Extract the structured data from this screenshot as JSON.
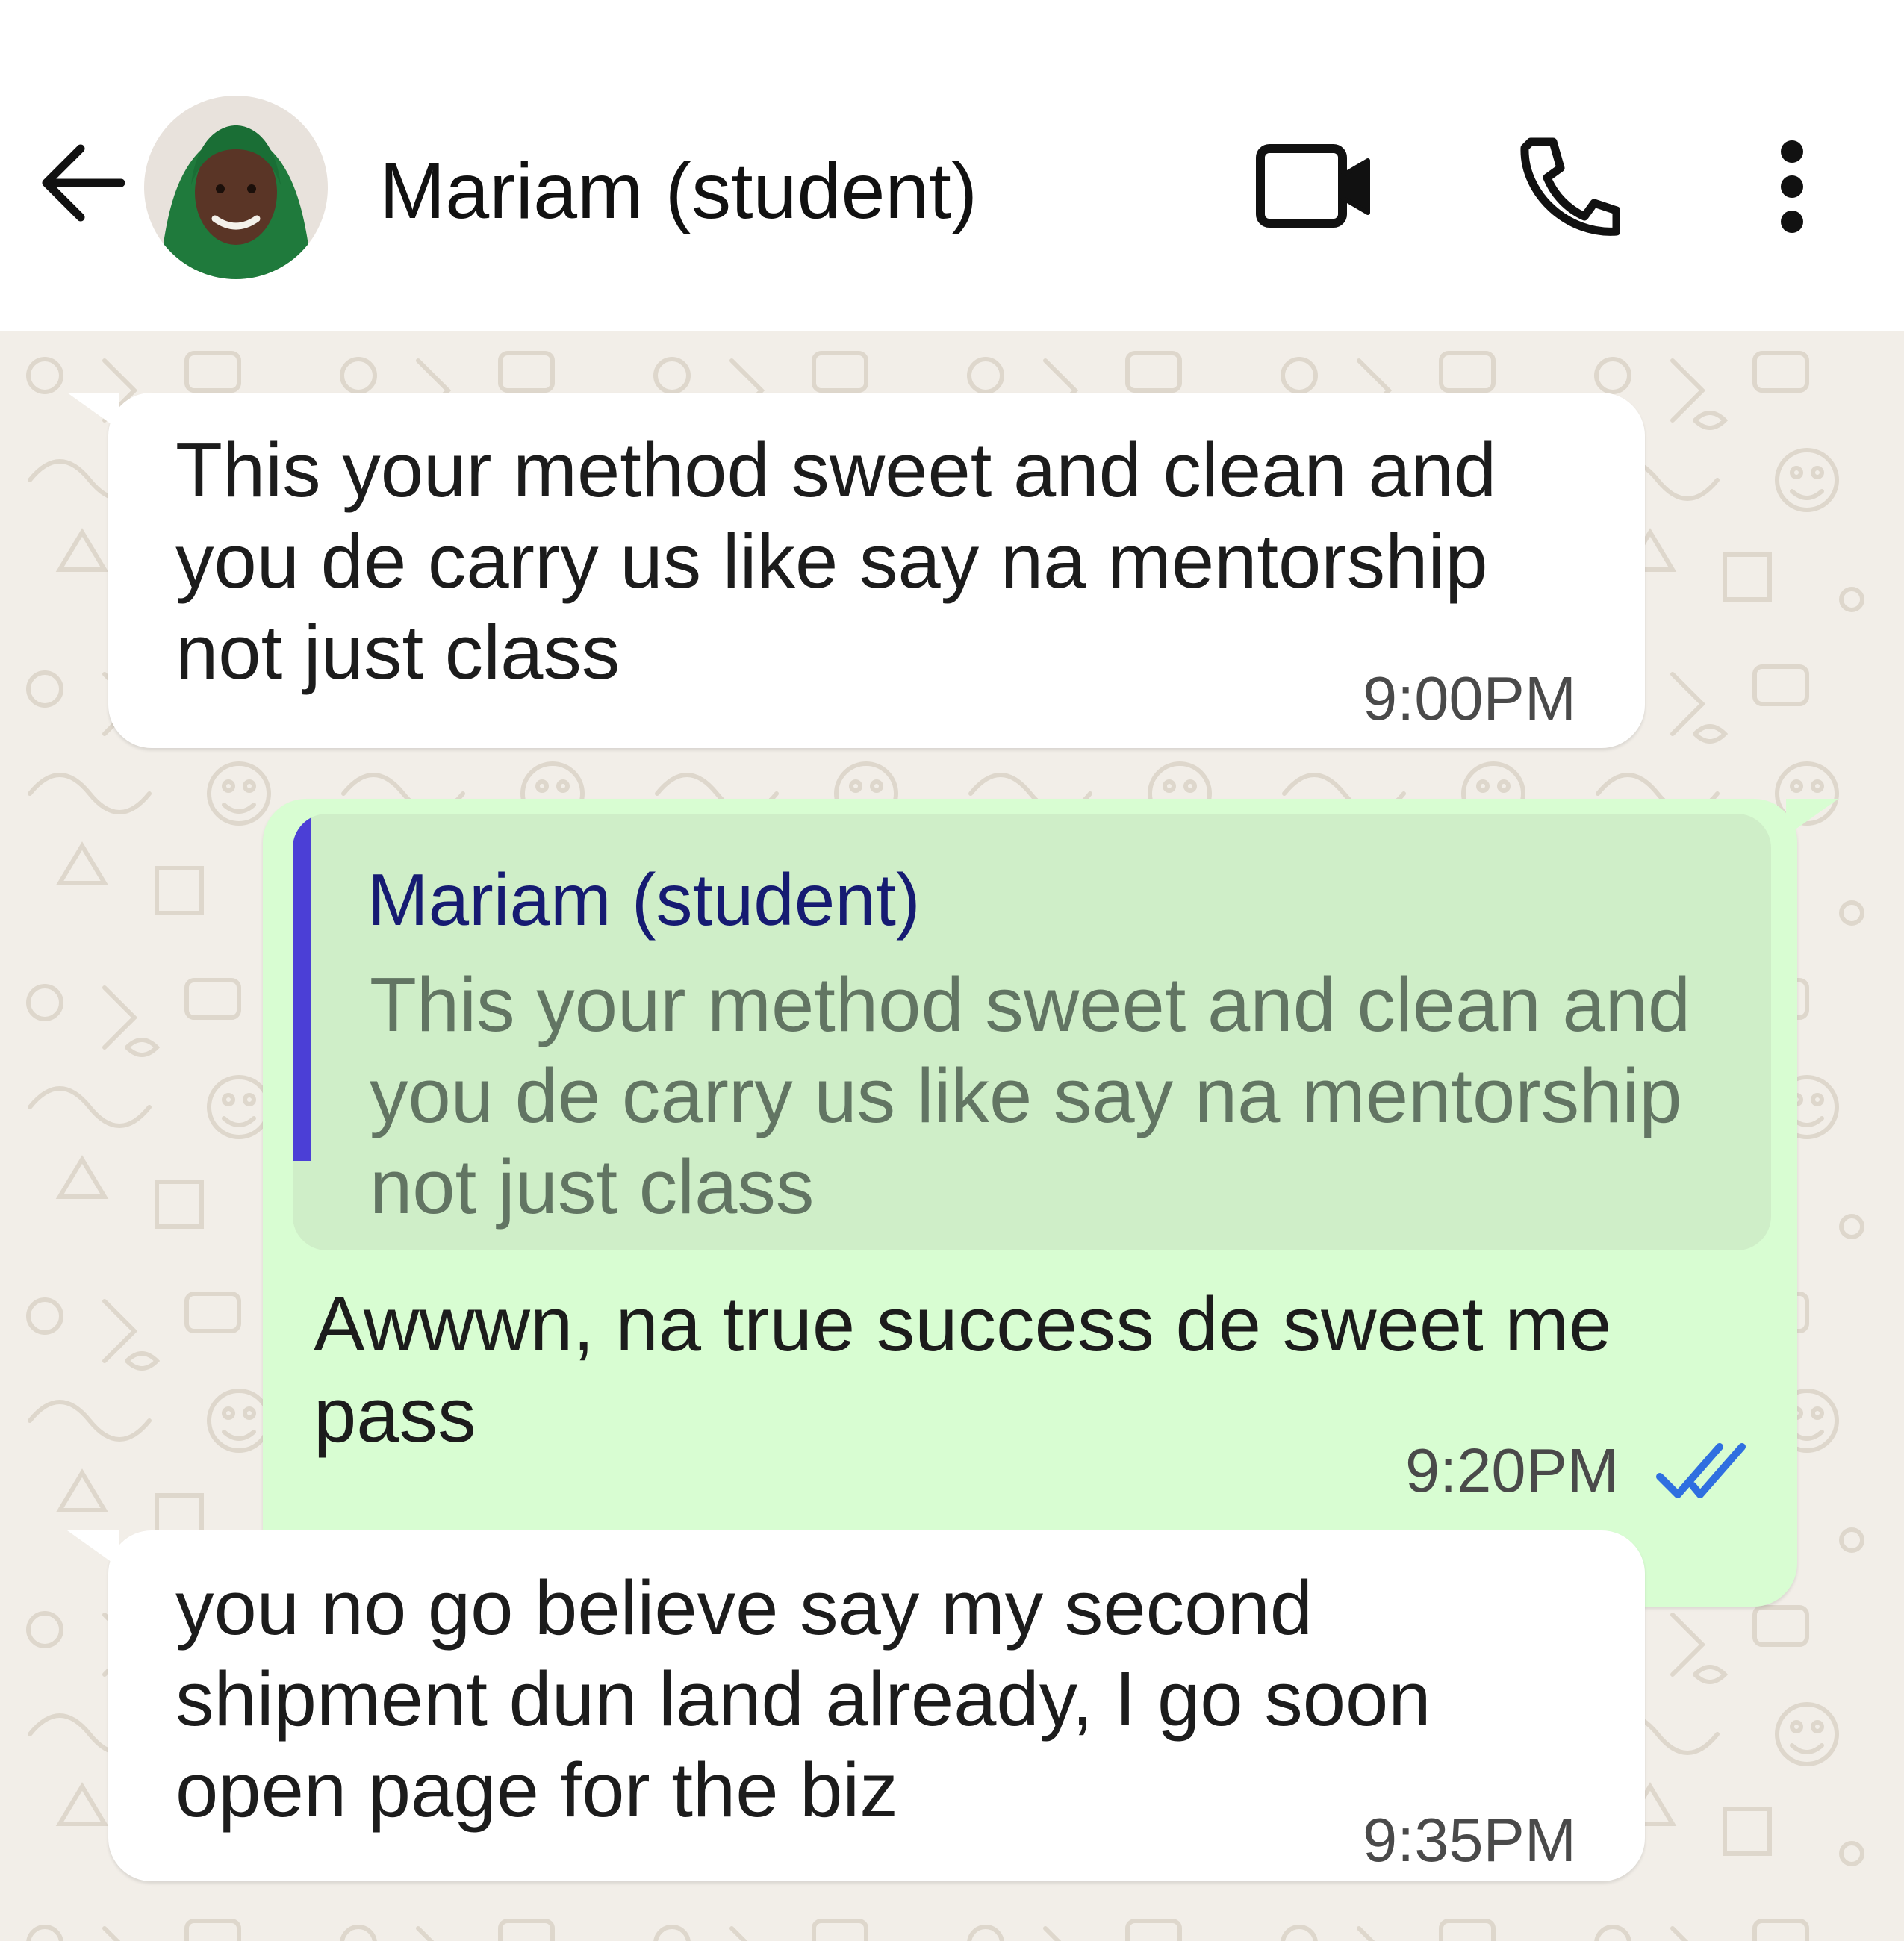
{
  "header": {
    "contact_name": "Mariam (student)"
  },
  "icons": {
    "back": "arrow-left-icon",
    "video": "video-camera-icon",
    "call": "phone-icon",
    "menu": "more-vertical-icon",
    "read_receipt": "double-check-icon"
  },
  "colors": {
    "incoming_bubble": "#ffffff",
    "outgoing_bubble": "#d8fdd2",
    "quote_background": "#cfeec8",
    "quote_bar": "#4b3fd6",
    "quote_author": "#161b72",
    "read_receipt": "#2f6fe0",
    "wallpaper": "#f2eee8"
  },
  "messages": [
    {
      "direction": "incoming",
      "lines": [
        "This your method sweet and clean and",
        "you de carry us like say na mentorship",
        "not just class"
      ],
      "time": "9:00PM"
    },
    {
      "direction": "outgoing",
      "quote": {
        "author": "Mariam (student)",
        "lines": [
          "This your method sweet and clean and",
          "you de carry us like say na mentorship",
          "not just class"
        ]
      },
      "lines": [
        "Awwwn, na true success de sweet me",
        "pass"
      ],
      "time": "9:20PM",
      "status": "read"
    },
    {
      "direction": "incoming",
      "lines": [
        "you no go believe say my second",
        "shipment dun land already, I go soon",
        "open page for the biz"
      ],
      "time": "9:35PM"
    }
  ]
}
